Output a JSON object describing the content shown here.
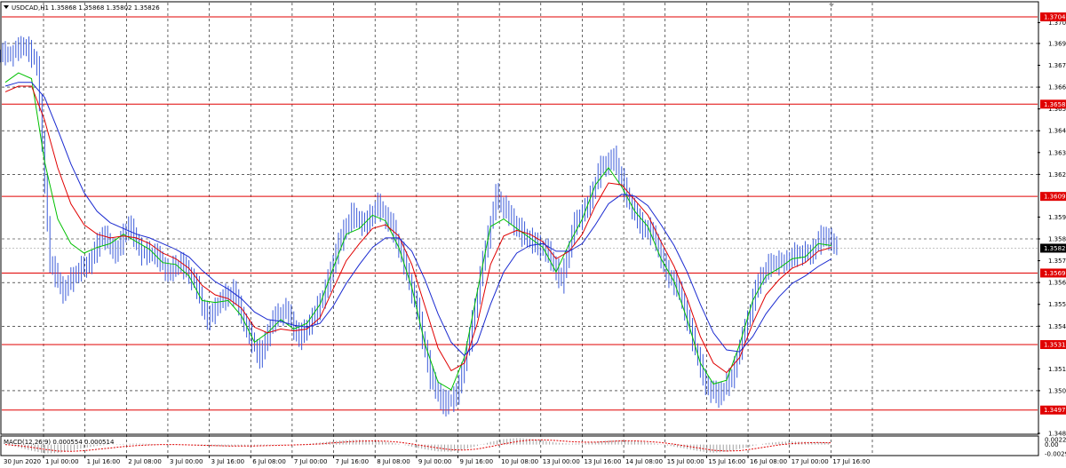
{
  "window": {
    "title": "USDCAD,H1  1.35868 1.35868 1.35802 1.35826",
    "collapse_icon": "triangle-down-icon",
    "scroll_marker_icon": "triangle-down-icon"
  },
  "indicator_panel": {
    "title": "MACD(12,26,9) 0.000554 0.000514"
  },
  "colors": {
    "background": "#ffffff",
    "grid": "#000000",
    "price_bars": "#3b5bd9",
    "ma_fast": "#00c000",
    "ma_mid": "#e00000",
    "ma_slow": "#1a2ad0",
    "levels": "#e00000",
    "macd_hist": "#a0a0a0",
    "macd_signal": "#e00000",
    "current_price_tag": "#000000"
  },
  "price_axis": {
    "ticks": [
      "1.37015",
      "1.36905",
      "1.36790",
      "1.36675",
      "1.36560",
      "1.36445",
      "1.36330",
      "1.36215",
      "1.35990",
      "1.35875",
      "1.35760",
      "1.35645",
      "1.35530",
      "1.35415",
      "1.35190",
      "1.35075",
      "1.34850"
    ],
    "level_labels": [
      "1.37045",
      "1.36585",
      "1.36099",
      "1.35695",
      "1.35318",
      "1.34973"
    ],
    "current_price": "1.35826"
  },
  "macd_axis": {
    "ticks": [
      "0.00225",
      "0.00",
      "-0.00297"
    ]
  },
  "time_axis": {
    "labels": [
      "30 Jun 2020",
      "1 Jul 00:00",
      "1 Jul 16:00",
      "2 Jul 08:00",
      "3 Jul 00:00",
      "3 Jul 16:00",
      "6 Jul 08:00",
      "7 Jul 00:00",
      "7 Jul 16:00",
      "8 Jul 08:00",
      "9 Jul 00:00",
      "9 Jul 16:00",
      "10 Jul 08:00",
      "13 Jul 00:00",
      "13 Jul 16:00",
      "14 Jul 08:00",
      "15 Jul 00:00",
      "15 Jul 16:00",
      "16 Jul 08:00",
      "17 Jul 00:00",
      "17 Jul 16:00"
    ]
  },
  "chart_data": {
    "type": "line",
    "symbol": "USDCAD",
    "timeframe": "H1",
    "ylim": [
      1.3485,
      1.3712
    ],
    "horizontal_levels": [
      1.37045,
      1.36585,
      1.36099,
      1.35695,
      1.35318,
      1.34973
    ],
    "series": [
      {
        "kind": "close",
        "values": [
          1.3685,
          1.369,
          1.368,
          1.3575,
          1.356,
          1.357,
          1.3575,
          1.359,
          1.358,
          1.3595,
          1.358,
          1.358,
          1.357,
          1.3575,
          1.3565,
          1.3545,
          1.3555,
          1.356,
          1.354,
          1.3525,
          1.3545,
          1.355,
          1.3535,
          1.3545,
          1.356,
          1.3585,
          1.36,
          1.3595,
          1.3605,
          1.3595,
          1.3575,
          1.355,
          1.3515,
          1.35,
          1.3505,
          1.3535,
          1.3575,
          1.361,
          1.36,
          1.359,
          1.3585,
          1.358,
          1.3565,
          1.3595,
          1.3605,
          1.3625,
          1.363,
          1.361,
          1.3595,
          1.359,
          1.357,
          1.356,
          1.3535,
          1.351,
          1.3505,
          1.3515,
          1.354,
          1.3565,
          1.3575,
          1.3575,
          1.358,
          1.358,
          1.359,
          1.3583
        ]
      },
      {
        "name": "MA fast",
        "values": [
          1.367,
          1.3675,
          1.3672,
          1.3628,
          1.3598,
          1.3585,
          1.358,
          1.3583,
          1.3585,
          1.359,
          1.3586,
          1.3582,
          1.3575,
          1.3574,
          1.3568,
          1.3555,
          1.3554,
          1.3555,
          1.3547,
          1.3533,
          1.3538,
          1.3545,
          1.354,
          1.3543,
          1.3553,
          1.3572,
          1.359,
          1.3593,
          1.36,
          1.3597,
          1.3583,
          1.3562,
          1.3532,
          1.3512,
          1.3508,
          1.3525,
          1.356,
          1.3594,
          1.3598,
          1.3593,
          1.3588,
          1.3583,
          1.357,
          1.3585,
          1.3598,
          1.3616,
          1.3625,
          1.3615,
          1.3602,
          1.3594,
          1.3577,
          1.3565,
          1.3545,
          1.3522,
          1.3511,
          1.3513,
          1.3532,
          1.3555,
          1.3568,
          1.3572,
          1.3577,
          1.3578,
          1.3585,
          1.3584
        ]
      },
      {
        "name": "MA mid",
        "values": [
          1.3665,
          1.3668,
          1.3668,
          1.365,
          1.3625,
          1.3606,
          1.3595,
          1.359,
          1.3588,
          1.3589,
          1.3588,
          1.3585,
          1.358,
          1.3577,
          1.3572,
          1.3563,
          1.3558,
          1.3556,
          1.3551,
          1.3541,
          1.3538,
          1.354,
          1.3539,
          1.354,
          1.3546,
          1.3561,
          1.3576,
          1.3585,
          1.3593,
          1.3595,
          1.3589,
          1.3574,
          1.3552,
          1.353,
          1.3518,
          1.3522,
          1.3543,
          1.3574,
          1.3589,
          1.3592,
          1.359,
          1.3586,
          1.3577,
          1.3581,
          1.359,
          1.3605,
          1.3617,
          1.3616,
          1.3608,
          1.36,
          1.3586,
          1.3573,
          1.3556,
          1.3536,
          1.3522,
          1.3517,
          1.3525,
          1.3543,
          1.3558,
          1.3566,
          1.3572,
          1.3575,
          1.3581,
          1.3583
        ]
      },
      {
        "name": "MA slow",
        "values": [
          1.3668,
          1.367,
          1.367,
          1.3662,
          1.3645,
          1.3627,
          1.3612,
          1.3602,
          1.3596,
          1.3593,
          1.359,
          1.3588,
          1.3585,
          1.3582,
          1.3578,
          1.3571,
          1.3565,
          1.3561,
          1.3556,
          1.3549,
          1.3545,
          1.3544,
          1.3542,
          1.3541,
          1.3543,
          1.3552,
          1.3564,
          1.3574,
          1.3583,
          1.3588,
          1.3588,
          1.3581,
          1.3566,
          1.3548,
          1.3533,
          1.3526,
          1.3533,
          1.3553,
          1.357,
          1.358,
          1.3584,
          1.3585,
          1.3581,
          1.3581,
          1.3585,
          1.3595,
          1.3606,
          1.3611,
          1.361,
          1.3605,
          1.3595,
          1.3584,
          1.357,
          1.3553,
          1.3538,
          1.3529,
          1.3528,
          1.3536,
          1.3548,
          1.3557,
          1.3564,
          1.3568,
          1.3573,
          1.3577
        ]
      }
    ],
    "macd": {
      "ylim": [
        -0.00297,
        0.00225
      ],
      "histogram": [
        0.0,
        -0.0008,
        -0.0018,
        -0.0026,
        -0.0025,
        -0.0018,
        -0.001,
        -0.0004,
        0.0,
        0.0002,
        0.0003,
        0.0002,
        0.0,
        -0.0001,
        -0.0002,
        -0.0004,
        -0.0005,
        -0.0005,
        -0.0004,
        -0.0003,
        -0.0002,
        -0.0001,
        0.0,
        0.0002,
        0.0006,
        0.001,
        0.0013,
        0.0014,
        0.0012,
        0.0008,
        0.0002,
        -0.0006,
        -0.0014,
        -0.002,
        -0.0021,
        -0.0014,
        -0.0004,
        0.0008,
        0.0016,
        0.0019,
        0.0017,
        0.0012,
        0.0006,
        0.0003,
        0.0004,
        0.0008,
        0.0012,
        0.0013,
        0.0011,
        0.0006,
        0.0001,
        -0.0006,
        -0.0013,
        -0.002,
        -0.0024,
        -0.0021,
        -0.0013,
        -0.0004,
        0.0004,
        0.0008,
        0.0009,
        0.0008,
        0.0007,
        0.0006
      ],
      "signal": [
        0.0,
        -0.0003,
        -0.0008,
        -0.0014,
        -0.0019,
        -0.002,
        -0.0018,
        -0.0014,
        -0.001,
        -0.0006,
        -0.0003,
        -0.0001,
        0.0,
        0.0,
        -0.0001,
        -0.0002,
        -0.0003,
        -0.0004,
        -0.0004,
        -0.0004,
        -0.0003,
        -0.0002,
        -0.0001,
        0.0,
        0.0002,
        0.0005,
        0.0008,
        0.001,
        0.0011,
        0.001,
        0.0007,
        0.0002,
        -0.0004,
        -0.001,
        -0.0015,
        -0.0016,
        -0.0013,
        -0.0006,
        0.0002,
        0.0009,
        0.0013,
        0.0014,
        0.0012,
        0.0009,
        0.0007,
        0.0007,
        0.0009,
        0.0011,
        0.0011,
        0.0009,
        0.0006,
        0.0001,
        -0.0005,
        -0.0011,
        -0.0017,
        -0.0019,
        -0.0018,
        -0.0013,
        -0.0007,
        -0.0001,
        0.0003,
        0.0005,
        0.0006,
        0.0005
      ]
    }
  }
}
